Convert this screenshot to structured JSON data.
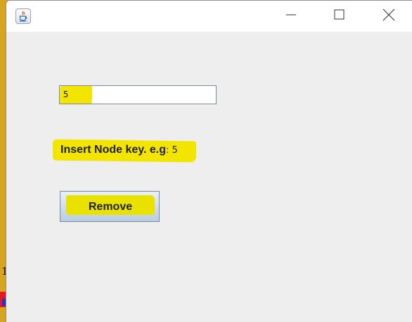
{
  "background_window": {
    "visible_text": "1"
  },
  "window": {
    "title": "",
    "app_icon": "java-icon",
    "controls": {
      "minimize_icon": "minimize-icon",
      "maximize_icon": "maximize-icon",
      "close_icon": "close-icon"
    }
  },
  "form": {
    "key_field": {
      "value": "5",
      "highlight_color": "#f3e500"
    },
    "instruction_label": {
      "text": "Insert Node key. e.g",
      "suffix": ": 5"
    },
    "remove_button": {
      "label": "Remove"
    }
  },
  "colors": {
    "highlight": "#f3e500",
    "content_bg": "#eeeeee",
    "titlebar_bg": "#ffffff",
    "background_window": "#d8a521"
  }
}
